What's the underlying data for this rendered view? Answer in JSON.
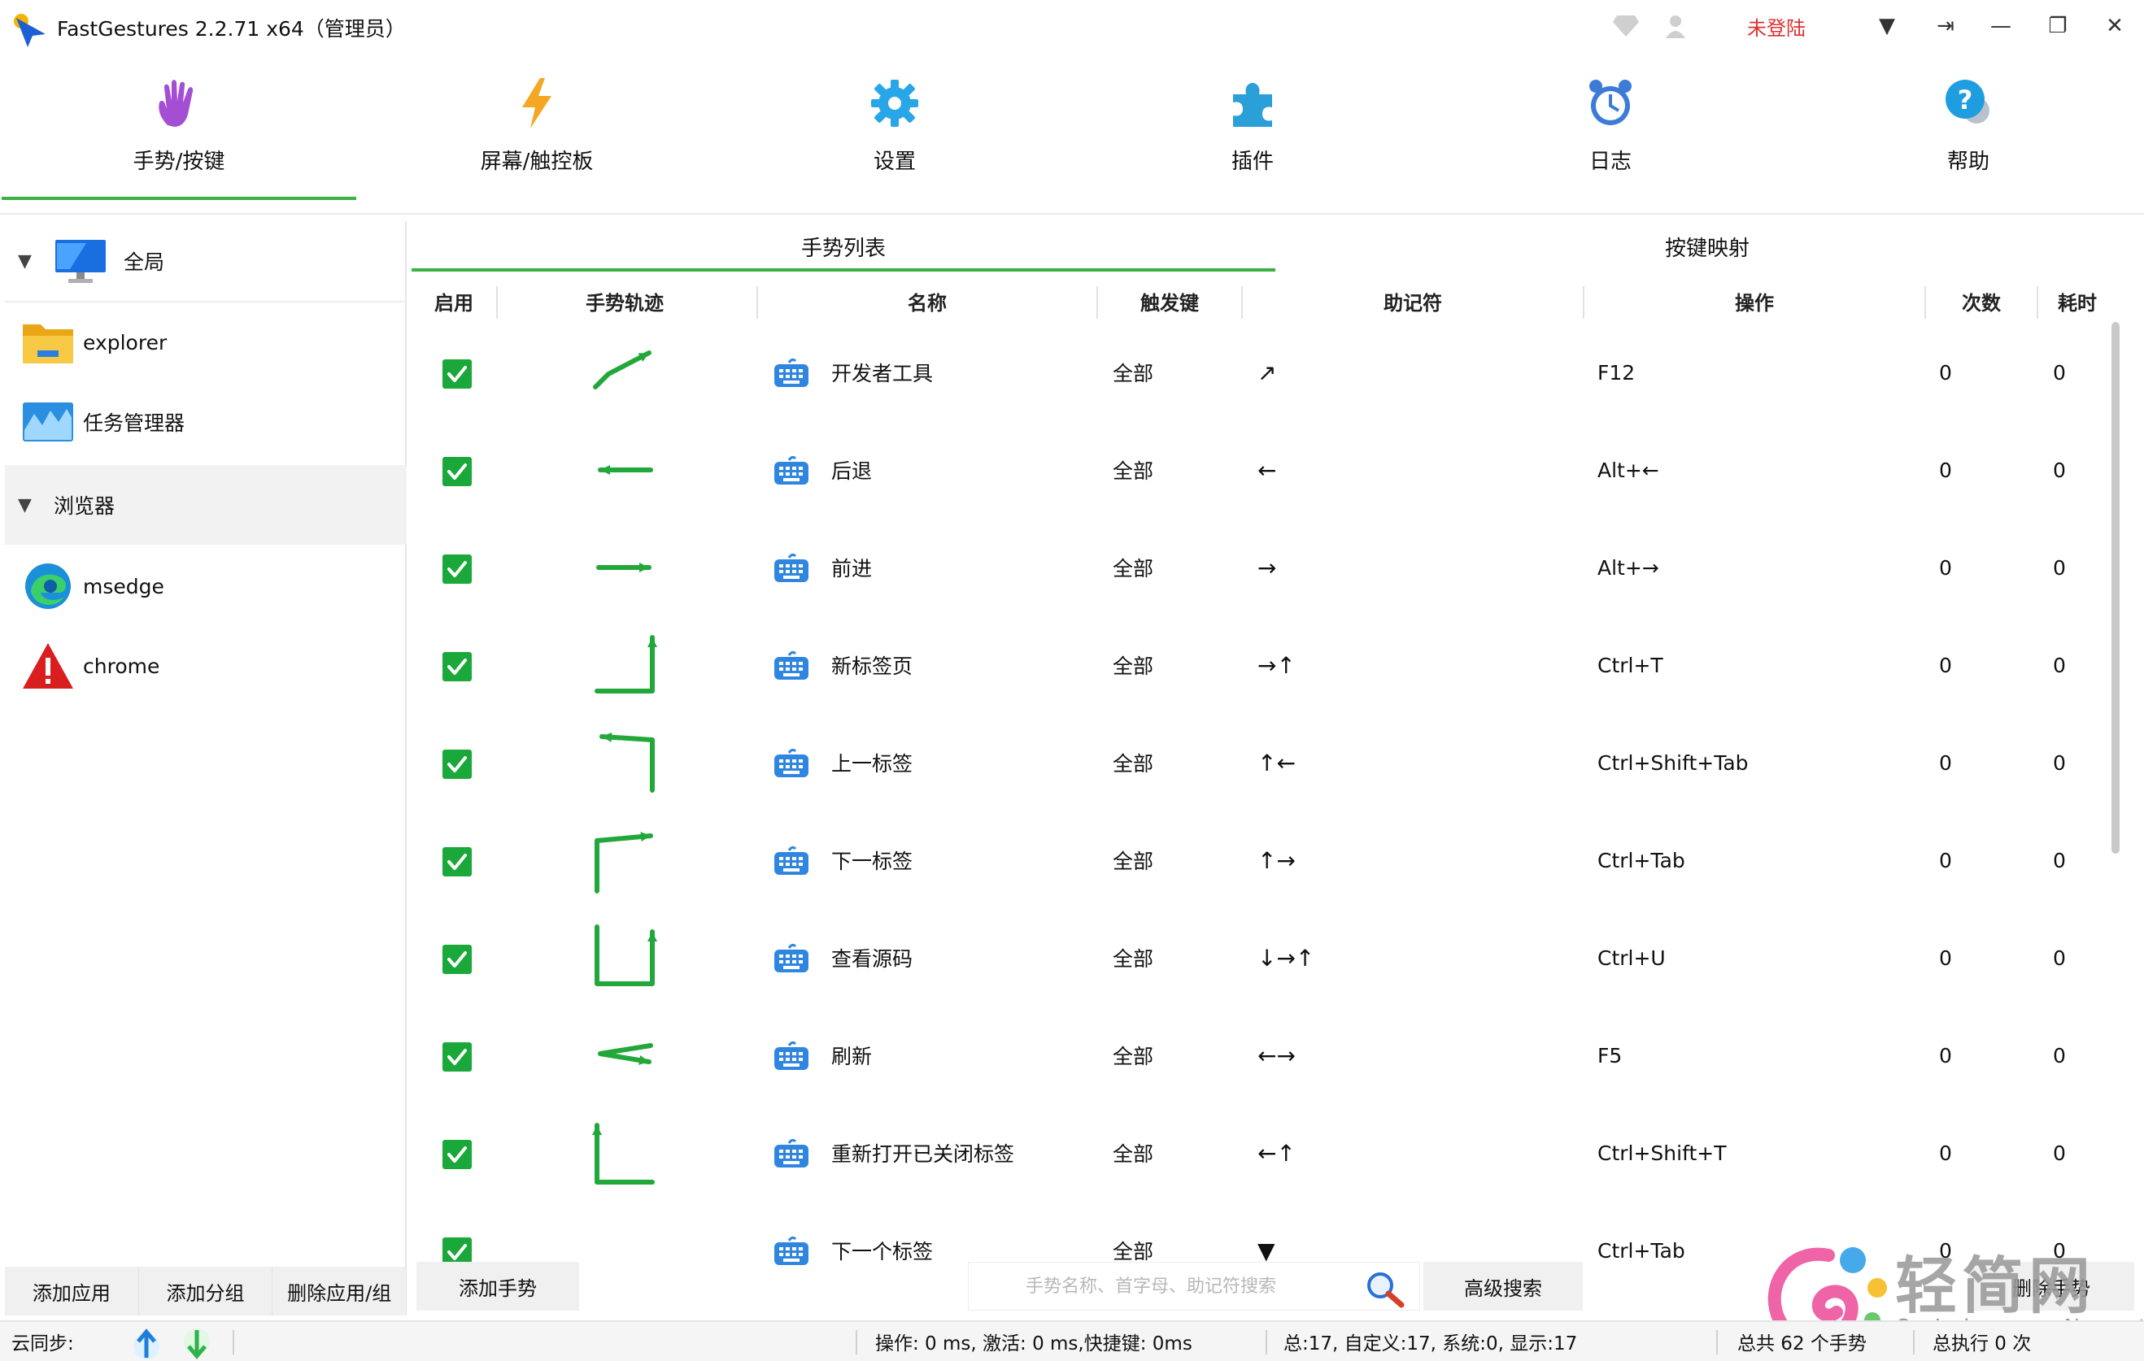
{
  "window": {
    "title": "FastGestures 2.2.71 x64（管理员）",
    "login_status": "未登陆",
    "controls": [
      "▼",
      "⇥",
      "—",
      "❐",
      "✕"
    ]
  },
  "nav": [
    {
      "label": "手势/按键",
      "icon": "hand-icon",
      "active": true
    },
    {
      "label": "屏幕/触控板",
      "icon": "lightning-icon",
      "active": false
    },
    {
      "label": "设置",
      "icon": "gear-icon",
      "active": false
    },
    {
      "label": "插件",
      "icon": "puzzle-icon",
      "active": false
    },
    {
      "label": "日志",
      "icon": "alarm-clock-icon",
      "active": false
    },
    {
      "label": "帮助",
      "icon": "help-icon",
      "active": false
    }
  ],
  "sidebar": {
    "items": [
      {
        "label": "全局",
        "icon": "monitor-icon",
        "type": "group",
        "caret": "▼"
      },
      {
        "label": "explorer",
        "icon": "folder-icon",
        "type": "app"
      },
      {
        "label": "任务管理器",
        "icon": "task-manager-icon",
        "type": "app"
      },
      {
        "label": "浏览器",
        "icon": "",
        "type": "group",
        "caret": "▼"
      },
      {
        "label": "msedge",
        "icon": "edge-icon",
        "type": "app"
      },
      {
        "label": "chrome",
        "icon": "warning-icon",
        "type": "app"
      }
    ],
    "footer": [
      "添加应用",
      "添加分组",
      "删除应用/组"
    ]
  },
  "section_tabs": {
    "gesture_list": "手势列表",
    "key_mapping": "按键映射"
  },
  "table": {
    "columns": [
      "启用",
      "手势轨迹",
      "名称",
      "触发键",
      "助记符",
      "操作",
      "次数",
      "耗时"
    ],
    "rows": [
      {
        "trail": "diagonal-up-right",
        "name": "开发者工具",
        "trigger": "全部",
        "mnemonic": "↗",
        "operation": "F12",
        "count": "0",
        "time": "0"
      },
      {
        "trail": "left",
        "name": "后退",
        "trigger": "全部",
        "mnemonic": "←",
        "operation": "Alt+←",
        "count": "0",
        "time": "0"
      },
      {
        "trail": "right",
        "name": "前进",
        "trigger": "全部",
        "mnemonic": "→",
        "operation": "Alt+→",
        "count": "0",
        "time": "0"
      },
      {
        "trail": "right-up",
        "name": "新标签页",
        "trigger": "全部",
        "mnemonic": "→↑",
        "operation": "Ctrl+T",
        "count": "0",
        "time": "0"
      },
      {
        "trail": "up-left",
        "name": "上一标签",
        "trigger": "全部",
        "mnemonic": "↑←",
        "operation": "Ctrl+Shift+Tab",
        "count": "0",
        "time": "0"
      },
      {
        "trail": "up-right",
        "name": "下一标签",
        "trigger": "全部",
        "mnemonic": "↑→",
        "operation": "Ctrl+Tab",
        "count": "0",
        "time": "0"
      },
      {
        "trail": "down-right-up",
        "name": "查看源码",
        "trigger": "全部",
        "mnemonic": "↓→↑",
        "operation": "Ctrl+U",
        "count": "0",
        "time": "0"
      },
      {
        "trail": "left-right",
        "name": "刷新",
        "trigger": "全部",
        "mnemonic": "←→",
        "operation": "F5",
        "count": "0",
        "time": "0"
      },
      {
        "trail": "left-up",
        "name": "重新打开已关闭标签",
        "trigger": "全部",
        "mnemonic": "←↑",
        "operation": "Ctrl+Shift+T",
        "count": "0",
        "time": "0"
      },
      {
        "trail": "none",
        "name": "下一个标签",
        "trigger": "全部",
        "mnemonic": "▼",
        "operation": "Ctrl+Tab",
        "count": "0",
        "time": "0"
      }
    ]
  },
  "tools": {
    "add_gesture": "添加手势",
    "search_placeholder": "手势名称、首字母、助记符搜索",
    "advanced_search": "高级搜索",
    "delete_gesture": "删除手势"
  },
  "watermark": {
    "main": "轻简网",
    "sub": "QJianNet"
  },
  "status": {
    "cloud_sync": "云同步:",
    "timing": "操作: 0 ms, 激活: 0 ms,快捷键: 0ms",
    "totals": "总:17, 自定义:17, 系统:0, 显示:17",
    "gesture_total": "总共 62 个手势",
    "exec_total": "总执行 0 次"
  },
  "colors": {
    "accent_green": "#3cb043",
    "checkbox_green": "#19a839",
    "login_red": "#e03030"
  }
}
